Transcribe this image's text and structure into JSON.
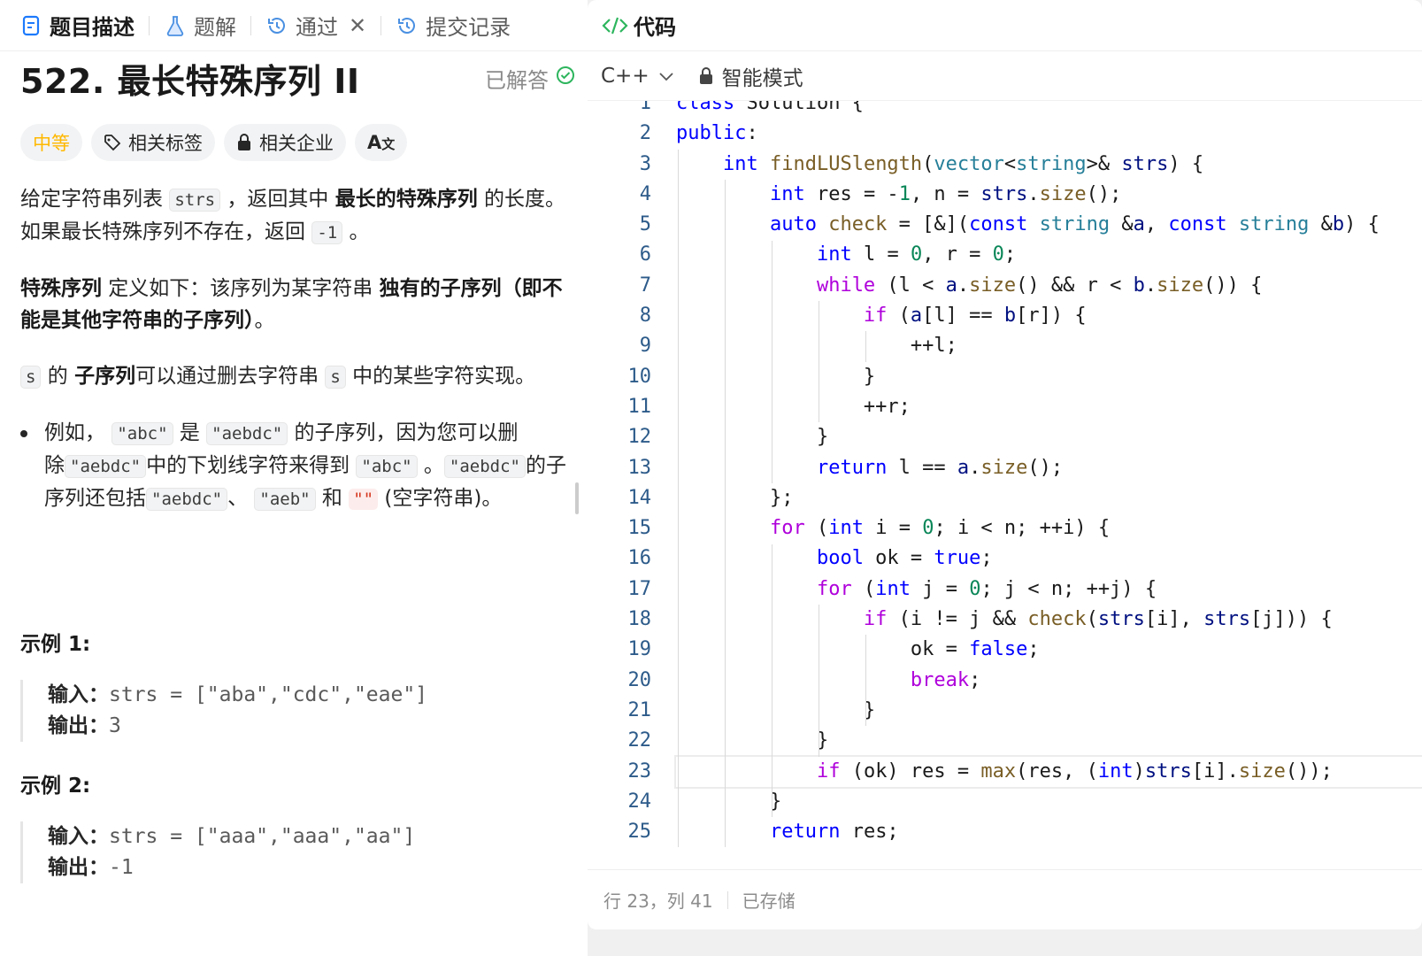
{
  "tabs": [
    {
      "label": "题目描述",
      "icon": "description-icon",
      "active": true
    },
    {
      "label": "题解",
      "icon": "flask-icon"
    },
    {
      "label": "通过",
      "icon": "history-icon",
      "closable": true
    },
    {
      "label": "提交记录",
      "icon": "history-icon"
    }
  ],
  "problem": {
    "title": "522. 最长特殊序列 II",
    "status": "已解答",
    "difficulty": "中等",
    "chips": [
      "相关标签",
      "相关企业",
      "A文"
    ],
    "colors": {
      "difficulty": "#ffb800",
      "solved_check": "#2db55d"
    }
  },
  "description": {
    "p1_a": "给定字符串列表 ",
    "p1_code": "strs",
    "p1_b": " ，返回其中 ",
    "p1_bold": "最长的特殊序列",
    "p1_c": " 的长度。如果最长特殊序列不存在，返回 ",
    "p1_code2": "-1",
    "p1_d": " 。",
    "p2_bold": "特殊序列",
    "p2_a": " 定义如下：该序列为某字符串 ",
    "p2_bold2": "独有的子序列（即不能是其他字符串的子序列）",
    "p2_b": "。",
    "p3_code": "s",
    "p3_a": " 的 ",
    "p3_bold": "子序列",
    "p3_b": "可以通过删去字符串 ",
    "p3_code2": "s",
    "p3_c": " 中的某些字符实现。",
    "li_a": "例如， ",
    "li_code1": "\"abc\"",
    "li_b": " 是 ",
    "li_code2": "\"aebdc\"",
    "li_c": " 的子序列，因为您可以删除",
    "li_code3": "\"aebdc\"",
    "li_d": "中的下划线字符来得到 ",
    "li_code4": "\"abc\"",
    "li_e": " 。",
    "li_code5": "\"aebdc\"",
    "li_f": "的子序列还包括",
    "li_code6": "\"aebdc\"",
    "li_g": "、 ",
    "li_code7": "\"aeb\"",
    "li_h": " 和 ",
    "li_code8": "\"\"",
    "li_i": " (空字符串)。"
  },
  "examples": [
    {
      "title": "示例 1:",
      "input_label": "输入：",
      "input": "strs = [\"aba\",\"cdc\",\"eae\"]",
      "output_label": "输出：",
      "output": "3"
    },
    {
      "title": "示例 2:",
      "input_label": "输入：",
      "input": "strs = [\"aaa\",\"aaa\",\"aa\"]",
      "output_label": "输出：",
      "output": "-1"
    }
  ],
  "editor": {
    "header": "代码",
    "language": "C++",
    "mode": "智能模式",
    "current_line": 23,
    "lines": [
      "class Solution {",
      "public:",
      "    int findLUSlength(vector<string>& strs) {",
      "        int res = -1, n = strs.size();",
      "        auto check = [&](const string &a, const string &b) {",
      "            int l = 0, r = 0;",
      "            while (l < a.size() && r < b.size()) {",
      "                if (a[l] == b[r]) {",
      "                    ++l;",
      "                }",
      "                ++r;",
      "            }",
      "            return l == a.size();",
      "        };",
      "        for (int i = 0; i < n; ++i) {",
      "            bool ok = true;",
      "            for (int j = 0; j < n; ++j) {",
      "                if (i != j && check(strs[i], strs[j])) {",
      "                    ok = false;",
      "                    break;",
      "                }",
      "            }",
      "            if (ok) res = max(res, (int)strs[i].size());",
      "        }",
      "        return res;"
    ]
  },
  "status_bar": {
    "position": "行 23，列 41",
    "saved": "已存储"
  }
}
